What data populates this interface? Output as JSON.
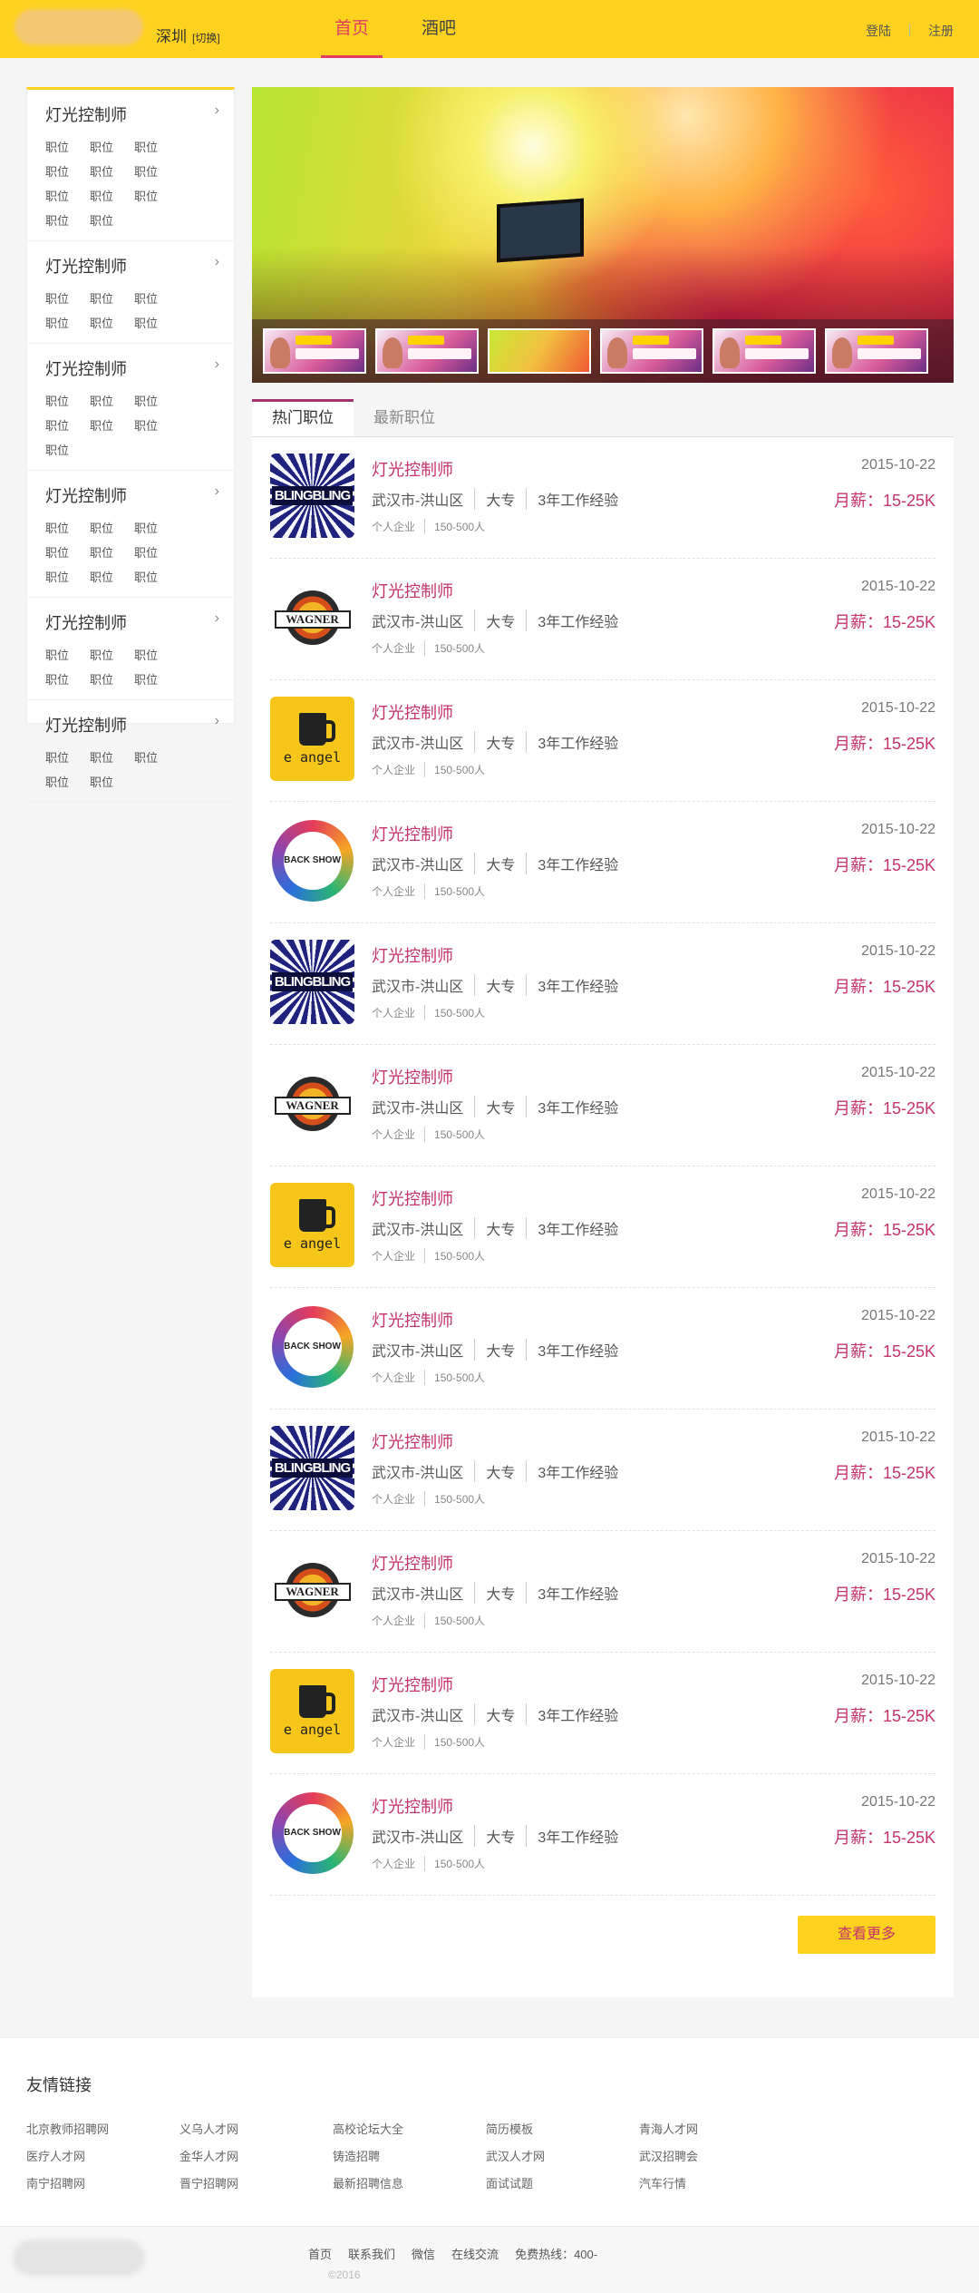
{
  "header": {
    "city": "深圳",
    "switch": "[切换]",
    "nav": [
      "首页",
      "酒吧"
    ],
    "login": "登陆",
    "register": "注册"
  },
  "sidebar": {
    "categories": [
      {
        "title": "灯光控制师",
        "items": [
          "职位",
          "职位",
          "职位",
          "职位",
          "职位",
          "职位",
          "职位",
          "职位",
          "职位",
          "职位",
          "职位"
        ]
      },
      {
        "title": "灯光控制师",
        "items": [
          "职位",
          "职位",
          "职位",
          "职位",
          "职位",
          "职位"
        ]
      },
      {
        "title": "灯光控制师",
        "items": [
          "职位",
          "职位",
          "职位",
          "职位",
          "职位",
          "职位",
          "职位"
        ]
      },
      {
        "title": "灯光控制师",
        "items": [
          "职位",
          "职位",
          "职位",
          "职位",
          "职位",
          "职位",
          "职位",
          "职位",
          "职位"
        ]
      },
      {
        "title": "灯光控制师",
        "items": [
          "职位",
          "职位",
          "职位",
          "职位",
          "职位",
          "职位"
        ]
      },
      {
        "title": "灯光控制师",
        "items": [
          "职位",
          "职位",
          "职位",
          "职位",
          "职位"
        ]
      }
    ]
  },
  "tabs": [
    "热门职位",
    "最新职位"
  ],
  "jobs": [
    {
      "logo": "bling",
      "title": "灯光控制师",
      "location": "武汉市-洪山区",
      "edu": "大专",
      "exp": "3年工作经验",
      "type": "个人企业",
      "size": "150-500人",
      "date": "2015-10-22",
      "salary": "月薪：15-25K"
    },
    {
      "logo": "wagner",
      "title": "灯光控制师",
      "location": "武汉市-洪山区",
      "edu": "大专",
      "exp": "3年工作经验",
      "type": "个人企业",
      "size": "150-500人",
      "date": "2015-10-22",
      "salary": "月薪：15-25K"
    },
    {
      "logo": "angel",
      "title": "灯光控制师",
      "location": "武汉市-洪山区",
      "edu": "大专",
      "exp": "3年工作经验",
      "type": "个人企业",
      "size": "150-500人",
      "date": "2015-10-22",
      "salary": "月薪：15-25K"
    },
    {
      "logo": "back",
      "title": "灯光控制师",
      "location": "武汉市-洪山区",
      "edu": "大专",
      "exp": "3年工作经验",
      "type": "个人企业",
      "size": "150-500人",
      "date": "2015-10-22",
      "salary": "月薪：15-25K"
    },
    {
      "logo": "bling",
      "title": "灯光控制师",
      "location": "武汉市-洪山区",
      "edu": "大专",
      "exp": "3年工作经验",
      "type": "个人企业",
      "size": "150-500人",
      "date": "2015-10-22",
      "salary": "月薪：15-25K"
    },
    {
      "logo": "wagner",
      "title": "灯光控制师",
      "location": "武汉市-洪山区",
      "edu": "大专",
      "exp": "3年工作经验",
      "type": "个人企业",
      "size": "150-500人",
      "date": "2015-10-22",
      "salary": "月薪：15-25K"
    },
    {
      "logo": "angel",
      "title": "灯光控制师",
      "location": "武汉市-洪山区",
      "edu": "大专",
      "exp": "3年工作经验",
      "type": "个人企业",
      "size": "150-500人",
      "date": "2015-10-22",
      "salary": "月薪：15-25K"
    },
    {
      "logo": "back",
      "title": "灯光控制师",
      "location": "武汉市-洪山区",
      "edu": "大专",
      "exp": "3年工作经验",
      "type": "个人企业",
      "size": "150-500人",
      "date": "2015-10-22",
      "salary": "月薪：15-25K"
    },
    {
      "logo": "bling",
      "title": "灯光控制师",
      "location": "武汉市-洪山区",
      "edu": "大专",
      "exp": "3年工作经验",
      "type": "个人企业",
      "size": "150-500人",
      "date": "2015-10-22",
      "salary": "月薪：15-25K"
    },
    {
      "logo": "wagner",
      "title": "灯光控制师",
      "location": "武汉市-洪山区",
      "edu": "大专",
      "exp": "3年工作经验",
      "type": "个人企业",
      "size": "150-500人",
      "date": "2015-10-22",
      "salary": "月薪：15-25K"
    },
    {
      "logo": "angel",
      "title": "灯光控制师",
      "location": "武汉市-洪山区",
      "edu": "大专",
      "exp": "3年工作经验",
      "type": "个人企业",
      "size": "150-500人",
      "date": "2015-10-22",
      "salary": "月薪：15-25K"
    },
    {
      "logo": "back",
      "title": "灯光控制师",
      "location": "武汉市-洪山区",
      "edu": "大专",
      "exp": "3年工作经验",
      "type": "个人企业",
      "size": "150-500人",
      "date": "2015-10-22",
      "salary": "月薪：15-25K"
    }
  ],
  "logo_text": {
    "bling": "BLINGBLING",
    "wagner": "WAGNER",
    "angel": "e angel",
    "back": "BACK SHOW"
  },
  "more_button": "查看更多",
  "friend_links": {
    "title": "友情链接",
    "links": [
      "北京教师招聘网",
      "义乌人才网",
      "高校论坛大全",
      "简历模板",
      "青海人才网",
      "医疗人才网",
      "金华人才网",
      "铸造招聘",
      "武汉人才网",
      "武汉招聘会",
      "南宁招聘网",
      "晋宁招聘网",
      "最新招聘信息",
      "面试试题",
      "汽车行情"
    ]
  },
  "footer": {
    "nav": [
      "首页",
      "联系我们",
      "微信",
      "在线交流",
      "免费热线：400-"
    ],
    "copyright": "©2016"
  },
  "colors": {
    "brand_yellow": "#fdd21f",
    "accent": "#c4336b"
  }
}
